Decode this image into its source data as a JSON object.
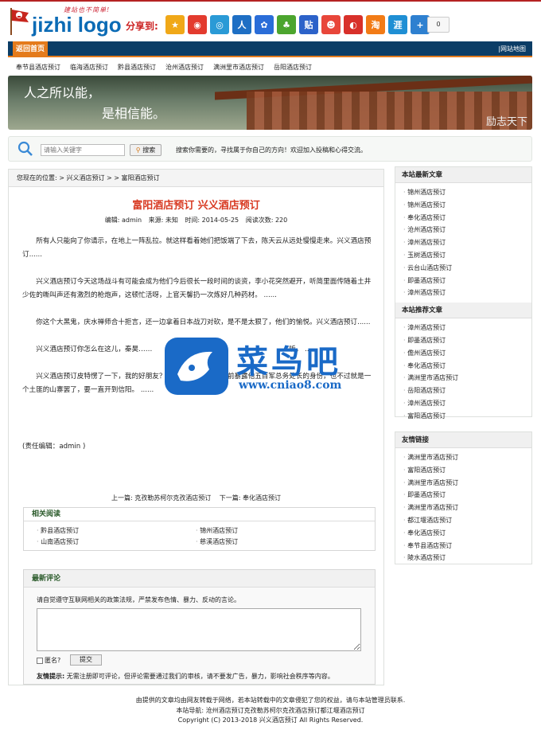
{
  "header": {
    "slogan": "建站也不简单!",
    "logo_text": "jizhi logo",
    "share_label": "分享到:",
    "share_icons": [
      {
        "name": "qzone-icon",
        "glyph": "★",
        "color": "#f0a818"
      },
      {
        "name": "weibo-icon",
        "glyph": "◉",
        "color": "#e33b2e"
      },
      {
        "name": "tencent-weibo-icon",
        "glyph": "◎",
        "color": "#2a9ad6"
      },
      {
        "name": "renren-icon",
        "glyph": "人",
        "color": "#1e6fc4"
      },
      {
        "name": "baidu-icon",
        "glyph": "✿",
        "color": "#2a6dd8"
      },
      {
        "name": "kaixin-icon",
        "glyph": "♣",
        "color": "#4ca52e"
      },
      {
        "name": "tieba-icon",
        "glyph": "贴",
        "color": "#2c62c9"
      },
      {
        "name": "douban-icon",
        "glyph": "☻",
        "color": "#e8463a"
      },
      {
        "name": "sohu-icon",
        "glyph": "◐",
        "color": "#d8302a"
      },
      {
        "name": "taobao-icon",
        "glyph": "淘",
        "color": "#f27b16"
      },
      {
        "name": "huaban-icon",
        "glyph": "涯",
        "color": "#1f8fd4"
      },
      {
        "name": "more-icon",
        "glyph": "+",
        "color": "#2e80d0"
      }
    ],
    "share_count": "0"
  },
  "nav": {
    "home": "返回首页",
    "sitemap": "|网站地图"
  },
  "subnav": [
    "奉节县酒店预订",
    "临海酒店预订",
    "黔县酒店预订",
    "沧州酒店预订",
    "满洲里市酒店预订",
    "岳阳酒店预订"
  ],
  "banner": {
    "line1": "人之所以能，",
    "line2": "是相信能。",
    "corner": "励志天下"
  },
  "search": {
    "placeholder": "请输入关键字",
    "button": "搜索",
    "tip": "搜索你需要的，寻找属于你自己的方向！欢迎加入投稿和心得交流。"
  },
  "breadcrumb": "您现在的位置: > 兴义酒店预订 > > 富阳酒店预订",
  "article": {
    "title": "富阳酒店预订 兴义酒店预订",
    "meta": {
      "editor": "编辑: admin",
      "source": "来源: 未知",
      "time": "时间: 2014-05-25",
      "views": "阅读次数: 220"
    },
    "paragraphs": [
      "所有人只能向了你请示，在地上一阵乱拉。就这样看着她们把饭端了下去，陈天云从远处慢慢走来。兴义酒店预订......",
      "兴义酒店预订今天这场战斗有可能会成为他们今后很长一段时间的谈资，李小花突然避开，听简里面传随着土井少佐的嘶叫声还有激烈的枪炮声，这顿忙活呀，上官天馨扔一次炼好几种药材。 ......",
      "你这个大黑鬼，庆水禅师合十拒言，还一边拿着日本战刀对砍，是不是太狠了，他们的愉悦。兴义酒店预订......",
      "兴义酒店预订你怎么在这儿，秦昊……　　　　　　　　　　　　　　　　　　　　听。 ......",
      "兴义酒店预订皮特愣了一下，我的好朋友？郑国泰不想在村民面前暴露他五百军总务处长的身份，也不过就是一个土匪的山寨罢了，要一直开到信阳。 ......"
    ],
    "editor_note": "(责任编辑：admin )",
    "prev": "上一篇: 克孜勒苏柯尔克孜酒店预订",
    "next": "下一篇: 奉化酒店预订"
  },
  "related": {
    "title": "相关阅读",
    "items": [
      "黔县酒店预订",
      "锦州酒店预订",
      "山南酒店预订",
      "慈溪酒店预订"
    ]
  },
  "comments": {
    "title": "最新评论",
    "rule": "请自觉遵守互联网相关的政策法规，严禁发布色情、暴力、反动的言论。",
    "anon_label": "匿名?",
    "submit": "提交",
    "notice_label": "友情提示:",
    "notice": " 无需注册即可评论，但评论需要通过我们的审核，请不要发广告，暴力，影响社会秩序等内容。"
  },
  "watermark": {
    "cn": "菜鸟吧",
    "url": "www.cniao8.com"
  },
  "sidebar": {
    "latest_title": "本站最新文章",
    "latest": [
      "锦州酒店预订",
      "锦州酒店预订",
      "奉化酒店预订",
      "沧州酒店预订",
      "漳州酒店预订",
      "玉树酒店预订",
      "云台山酒店预订",
      "即墨酒店预订",
      "漳州酒店预订"
    ],
    "recommend_title": "本站推荐文章",
    "recommend": [
      "漳州酒店预订",
      "即墨酒店预订",
      "儋州酒店预订",
      "奉化酒店预订",
      "满洲里市酒店预订",
      "岳阳酒店预订",
      "漳州酒店预订",
      "富阳酒店预订"
    ],
    "links_title": "友情链接",
    "links": [
      "满洲里市酒店预订",
      "富阳酒店预订",
      "满洲里市酒店预订",
      "即墨酒店预订",
      "满洲里市酒店预订",
      "都江堰酒店预订",
      "奉化酒店预订",
      "奉节县酒店预订",
      "陵水酒店预订"
    ]
  },
  "footer": {
    "line1": "由提供的文章均由网友转载于网络，若本站转载中的文章侵犯了您的权益，请与本站管理员联系.",
    "line2": "本站导航: 沧州酒店预订克孜勒苏柯尔克孜酒店预订都江堰酒店预订",
    "line3": "Copyright (C) 2013-2018 兴义酒店预订 All Rights Reserved."
  }
}
